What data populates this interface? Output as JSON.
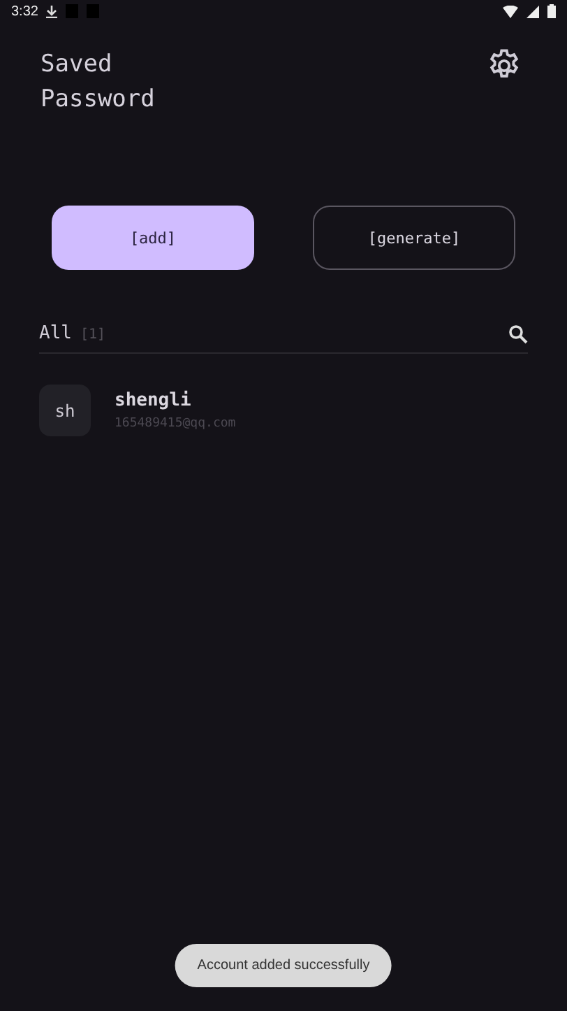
{
  "status_bar": {
    "time": "3:32"
  },
  "header": {
    "title": "Saved\nPassword"
  },
  "buttons": [
    {
      "label": "[add]",
      "kind": "filled"
    },
    {
      "label": "[generate]",
      "kind": "outlined"
    }
  ],
  "filter": {
    "label": "All",
    "count": "[1]"
  },
  "accounts": [
    {
      "initials": "sh",
      "name": "shengli",
      "email": "165489415@qq.com"
    }
  ],
  "toast": "Account added successfully"
}
